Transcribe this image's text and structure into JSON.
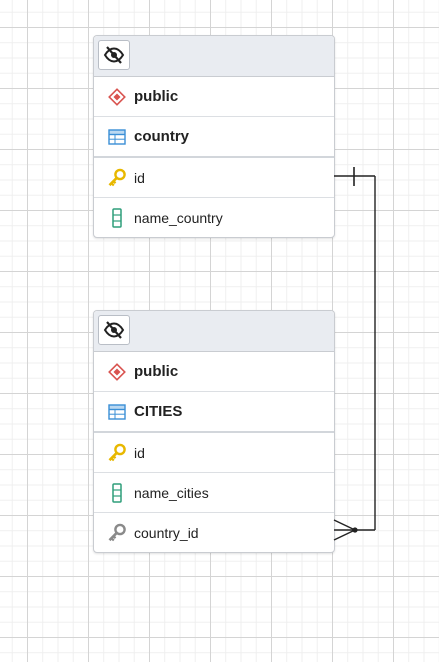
{
  "entities": [
    {
      "schema": "public",
      "table": "country",
      "columns": [
        {
          "name": "id",
          "icon": "primary-key-icon"
        },
        {
          "name": "name_country",
          "icon": "column-icon"
        }
      ]
    },
    {
      "schema": "public",
      "table": "CITIES",
      "columns": [
        {
          "name": "id",
          "icon": "primary-key-icon"
        },
        {
          "name": "name_cities",
          "icon": "column-icon"
        },
        {
          "name": "country_id",
          "icon": "foreign-key-icon"
        }
      ]
    }
  ],
  "colors": {
    "schema_icon": "#d9534f",
    "table_icon": "#3a8fd6",
    "primary_key": "#e8b800",
    "column_icon": "#2e9e7a",
    "foreign_key": "#8a8a8a",
    "relationship_line": "#222222"
  },
  "relationship": {
    "from": "CITIES.country_id",
    "to": "country.id",
    "cardinality": "many-to-one"
  }
}
